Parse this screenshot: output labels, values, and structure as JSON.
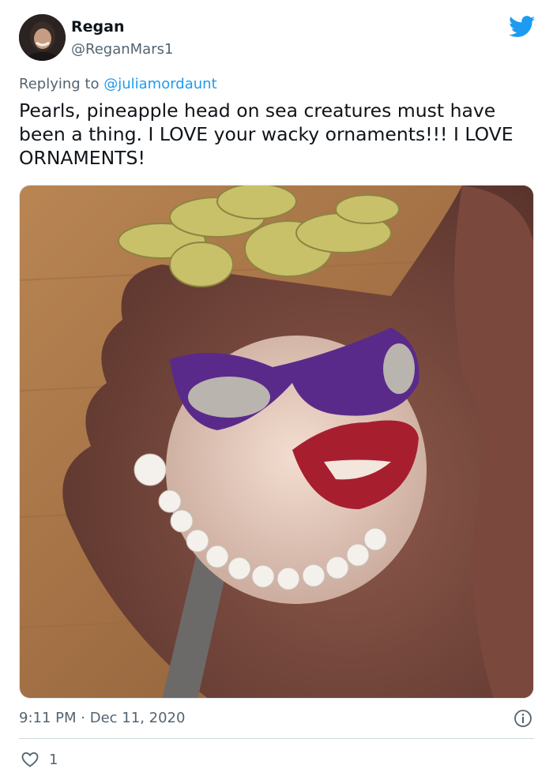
{
  "author": {
    "name": "Regan",
    "handle": "@ReganMars1"
  },
  "reply": {
    "prefix": "Replying to",
    "mention": "@juliamordaunt"
  },
  "tweet": {
    "text": "Pearls, pineapple head on sea creatures must have been a thing. I LOVE your wacky ornaments!!! I LOVE ORNAMENTS!"
  },
  "meta": {
    "time": "9:11 PM",
    "separator": "·",
    "date": "Dec 11, 2020"
  },
  "engagement": {
    "likes": "1"
  },
  "icons": {
    "brand": "twitter-bird-icon",
    "info": "info-icon",
    "like": "heart-icon"
  },
  "colors": {
    "brand": "#1d9bf0",
    "secondary_text": "#536471",
    "text": "#0f1419"
  }
}
